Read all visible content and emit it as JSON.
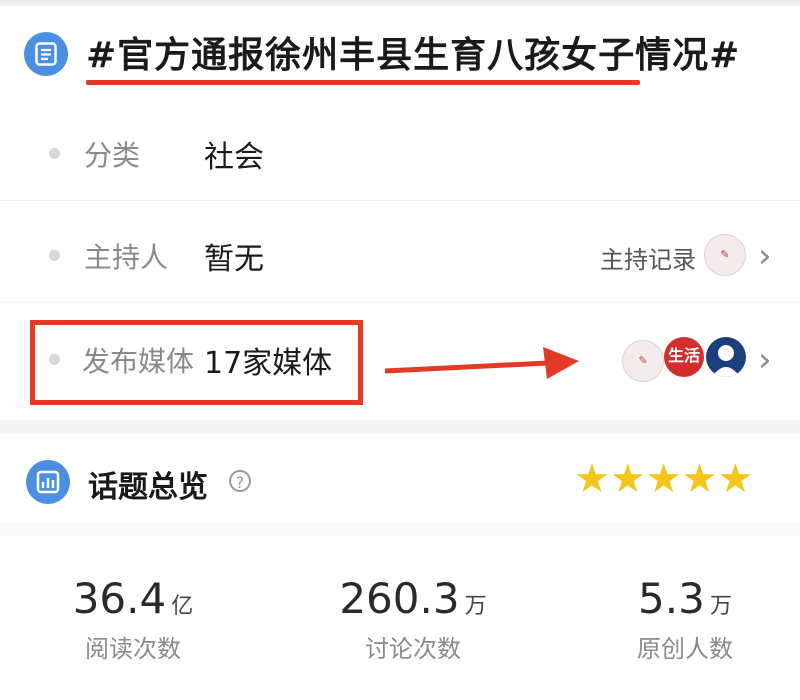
{
  "header": {
    "title": "#官方通报徐州丰县生育八孩女子情况#"
  },
  "rows": [
    {
      "label": "分类",
      "value": "社会"
    },
    {
      "label": "主持人",
      "value": "暂无",
      "right_label": "主持记录"
    },
    {
      "label": "发布媒体",
      "value": "17家媒体"
    }
  ],
  "media_avatars": {
    "life": "生活"
  },
  "overview": {
    "title": "话题总览",
    "help_glyph": "?",
    "star_count": 5,
    "star_color": "#f5c518"
  },
  "stats": [
    {
      "value": "36.4",
      "unit": "亿",
      "caption": "阅读次数"
    },
    {
      "value": "260.3",
      "unit": "万",
      "caption": "讨论次数"
    },
    {
      "value": "5.3",
      "unit": "万",
      "caption": "原创人数"
    }
  ],
  "colors": {
    "accent": "#4a8fe0",
    "highlight": "#e33a26"
  },
  "icons": {
    "header": "document-icon",
    "overview": "chart-icon",
    "chevron": "chevron-right-icon"
  }
}
